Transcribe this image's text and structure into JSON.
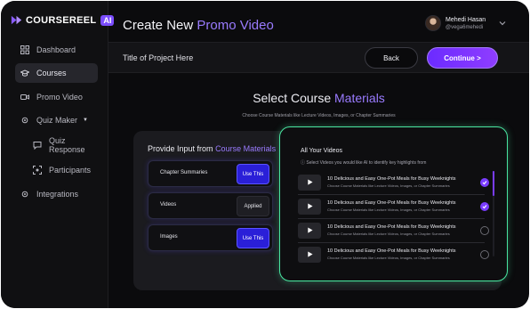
{
  "brand": {
    "name": "COURSEREEL",
    "badge": "AI",
    "accent": "#7b4dff"
  },
  "sidebar": {
    "items": [
      {
        "label": "Dashboard",
        "icon": "grid-icon"
      },
      {
        "label": "Courses",
        "icon": "graduation-cap-icon",
        "active": true
      },
      {
        "label": "Promo Video",
        "icon": "video-camera-icon"
      },
      {
        "label": "Quiz Maker",
        "icon": "gear-icon",
        "expandable": true
      },
      {
        "label": "Quiz Response",
        "icon": "chat-bubble-icon",
        "sub": true
      },
      {
        "label": "Participants",
        "icon": "scan-user-icon",
        "sub": true
      },
      {
        "label": "Integrations",
        "icon": "gear-icon"
      }
    ]
  },
  "header": {
    "title_prefix": "Create New",
    "title_accent": "Promo Video",
    "user": {
      "name": "Mehedi Hasan",
      "handle": "@vega6mehedi"
    }
  },
  "toolbar": {
    "project_title": "Title of Project Here",
    "back_label": "Back",
    "continue_label": "Continue >"
  },
  "main": {
    "title_prefix": "Select Course",
    "title_accent": "Materials",
    "subtitle": "Choose Course Materials like Lecture Videos, Images,  or Chapter Summaries"
  },
  "inputs": {
    "title_prefix": "Provide Input from",
    "title_accent": "Course Materials",
    "rows": [
      {
        "label": "Chapter Summaries",
        "button": "Use This",
        "state": "use"
      },
      {
        "label": "Videos",
        "button": "Applied",
        "state": "applied"
      },
      {
        "label": "Images",
        "button": "Use This",
        "state": "use"
      }
    ]
  },
  "videos": {
    "title": "All Your Videos",
    "hint": "Select Videos you would like AI to identify key highlights from",
    "items": [
      {
        "title": "10 Delicious and Easy One-Pot Meals for Busy Weeknights",
        "desc": "Choose Course Materials like Lecture Videos, Images,  or Chapter Summaries",
        "selected": true
      },
      {
        "title": "10 Delicious and Easy One-Pot Meals for Busy Weeknights",
        "desc": "Choose Course Materials like Lecture Videos, Images,  or Chapter Summaries",
        "selected": true
      },
      {
        "title": "10 Delicious and Easy One-Pot Meals for Busy Weeknights",
        "desc": "Choose Course Materials like Lecture Videos, Images,  or Chapter Summaries",
        "selected": false
      },
      {
        "title": "10 Delicious and Easy One-Pot Meals for Busy Weeknights",
        "desc": "Choose Course Materials like Lecture Videos, Images,  or Chapter Summaries",
        "selected": false
      }
    ]
  },
  "colors": {
    "accent_purple": "#9a7bff",
    "selected_green": "#49e5a0",
    "button_blue": "#2a1fd8"
  }
}
